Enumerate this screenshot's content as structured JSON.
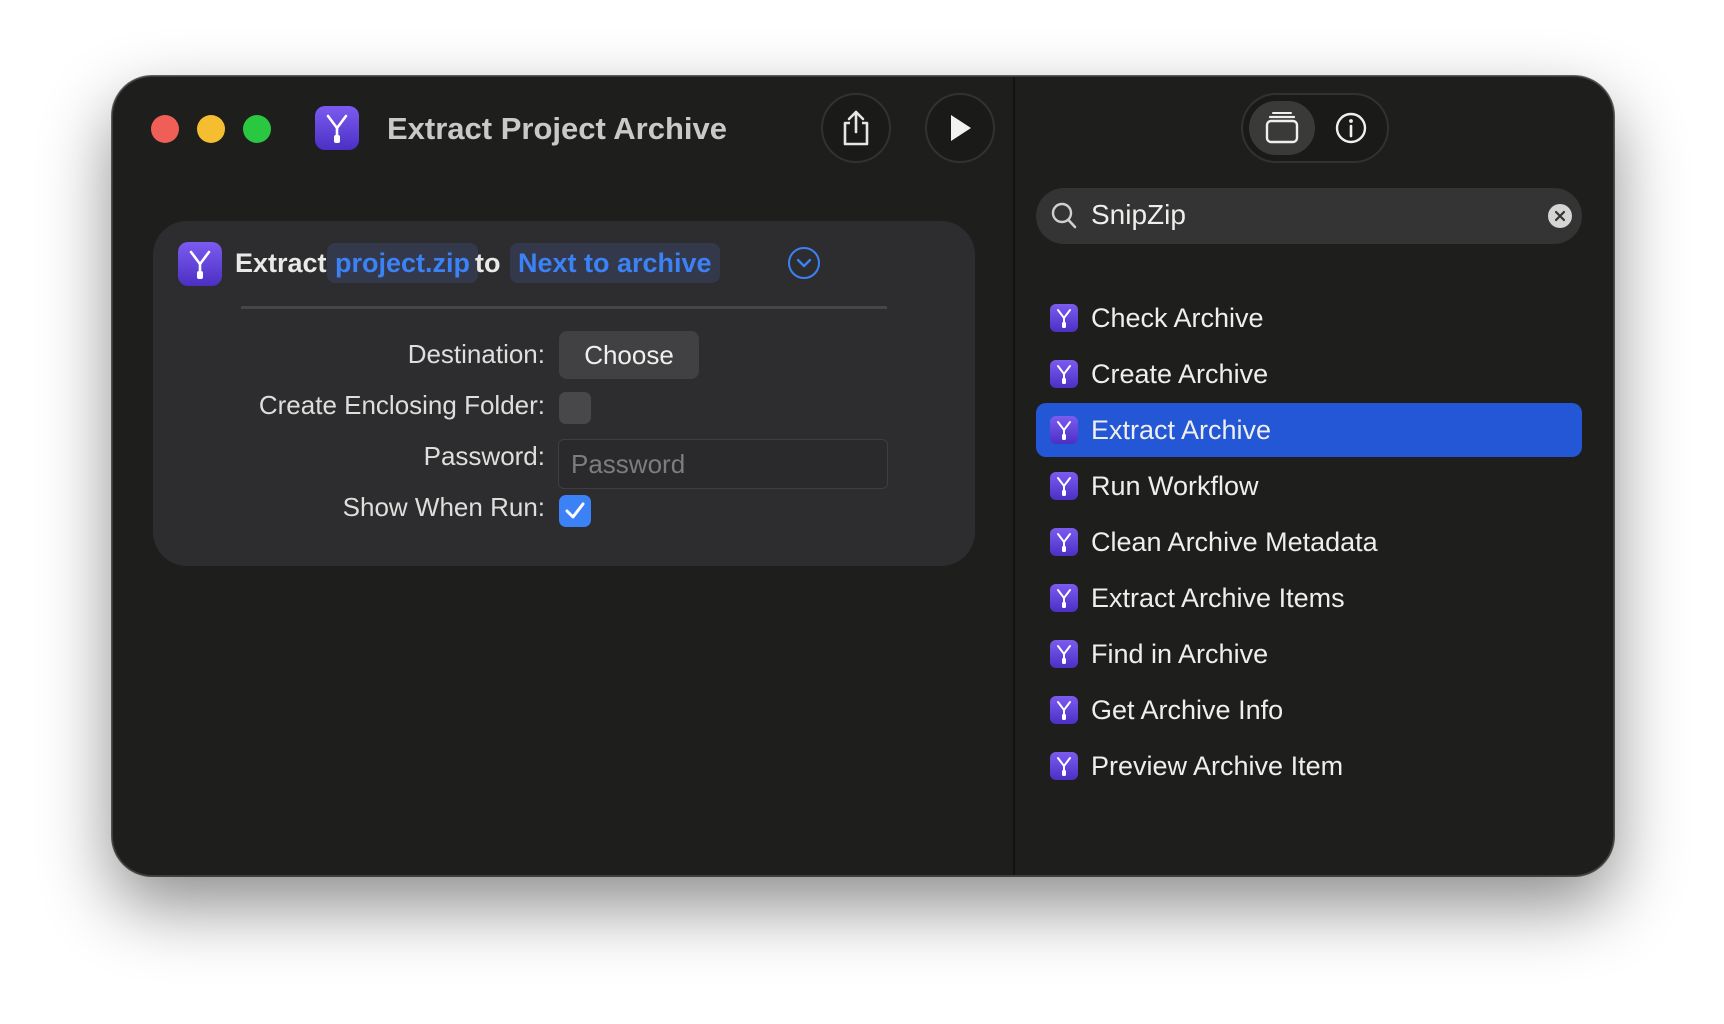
{
  "window": {
    "title": "Extract Project Archive",
    "app_icon": "zipper-icon"
  },
  "toolbar": {
    "share_icon": "share-icon",
    "run_icon": "play-icon",
    "library_icon": "library-icon",
    "info_icon": "info-icon"
  },
  "action": {
    "verb": "Extract",
    "source_token": "project.zip",
    "connector": "to",
    "destination_token": "Next to archive",
    "fields": {
      "destination_label": "Destination:",
      "destination_button": "Choose",
      "enclosing_folder_label": "Create Enclosing Folder:",
      "enclosing_folder_checked": false,
      "password_label": "Password:",
      "password_placeholder": "Password",
      "show_when_run_label": "Show When Run:",
      "show_when_run_checked": true
    }
  },
  "search": {
    "query": "SnipZip"
  },
  "actions_list": {
    "items": [
      {
        "label": "Check Archive",
        "selected": false
      },
      {
        "label": "Create Archive",
        "selected": false
      },
      {
        "label": "Extract Archive",
        "selected": true
      },
      {
        "label": "Run Workflow",
        "selected": false
      },
      {
        "label": "Clean Archive Metadata",
        "selected": false
      },
      {
        "label": "Extract Archive Items",
        "selected": false
      },
      {
        "label": "Find in Archive",
        "selected": false
      },
      {
        "label": "Get Archive Info",
        "selected": false
      },
      {
        "label": "Preview Archive Item",
        "selected": false
      }
    ]
  },
  "colors": {
    "accent": "#3b82f6",
    "selection": "#2457d6",
    "window_bg": "#1e1e1c",
    "card_bg": "#2d2d2f"
  }
}
